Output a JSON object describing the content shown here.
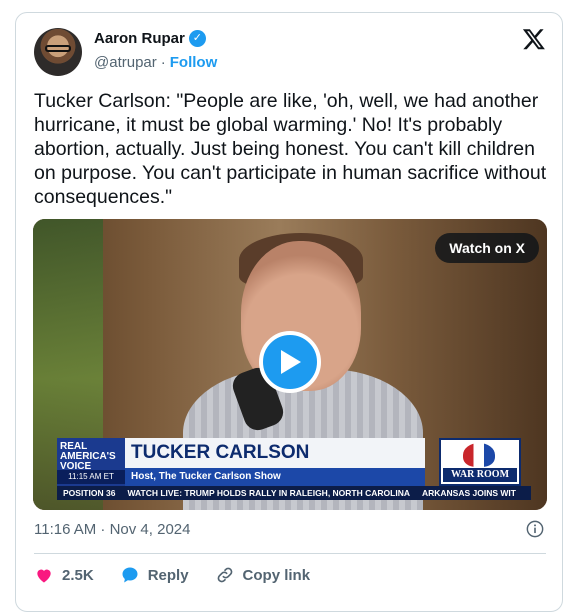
{
  "author": {
    "name": "Aaron Rupar",
    "handle": "@atrupar",
    "separator": "·",
    "follow_label": "Follow",
    "verified": true
  },
  "tweet": {
    "text": "Tucker Carlson: \"People are like, 'oh, well, we had another hurricane, it must be global warming.' No! It's probably abortion, actually. Just being honest. You can't kill children on purpose. You can't participate in human sacrifice without consequences.\""
  },
  "media": {
    "watch_label": "Watch on X",
    "overlay": {
      "channel_logo": "REAL AMERICA'S VOICE",
      "time": "11:15 AM ET",
      "name": "TUCKER CARLSON",
      "title": "Host, The Tucker Carlson Show",
      "ticker": [
        "POSITION 36",
        "WATCH LIVE: TRUMP HOLDS RALLY IN RALEIGH, NORTH CAROLINA",
        "ARKANSAS JOINS WIT"
      ],
      "show_logo": "WAR ROOM"
    }
  },
  "meta": {
    "timestamp": "11:16 AM · Nov 4, 2024"
  },
  "actions": {
    "likes": "2.5K",
    "reply_label": "Reply",
    "copy_label": "Copy link"
  },
  "colors": {
    "accent": "#1d9bf0",
    "like": "#f91880",
    "muted": "#536471"
  }
}
